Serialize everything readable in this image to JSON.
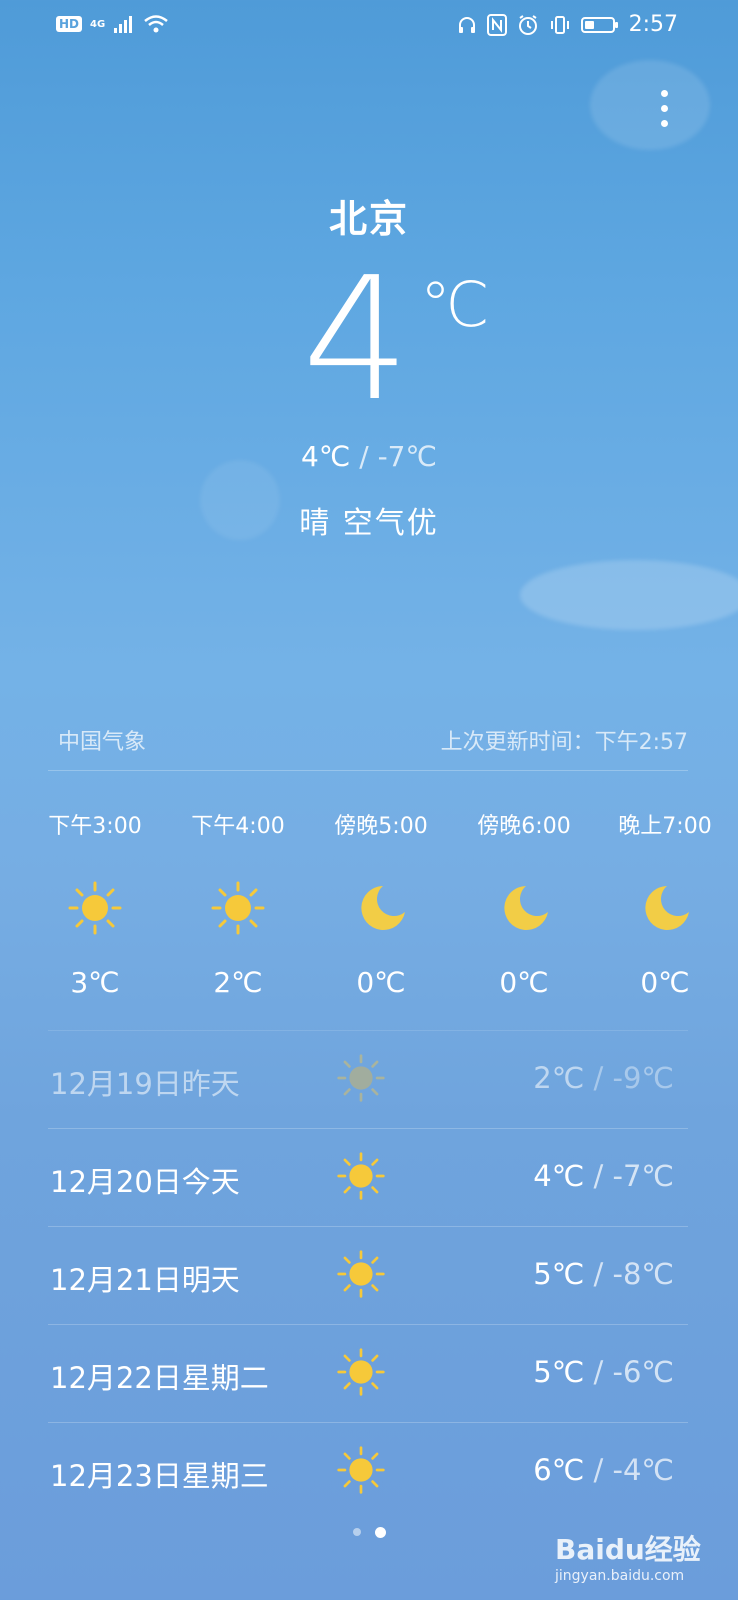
{
  "status_bar": {
    "hd": "HD",
    "network": "4G",
    "time": "2:57",
    "icons": [
      "signal-icon",
      "wifi-icon",
      "headset-icon",
      "nfc-icon",
      "alarm-icon",
      "vibrate-icon",
      "battery-icon"
    ]
  },
  "current": {
    "city": "北京",
    "temp": "4",
    "unit": "℃",
    "high": "4℃",
    "low": "-7℃",
    "condition": "晴",
    "air": "空气优"
  },
  "source": {
    "provider": "中国气象",
    "updated": "上次更新时间：下午2:57"
  },
  "hourly": [
    {
      "time": "下午3:00",
      "icon": "sun-icon",
      "temp": "3℃"
    },
    {
      "time": "下午4:00",
      "icon": "sun-icon",
      "temp": "2℃"
    },
    {
      "time": "傍晚5:00",
      "icon": "moon-icon",
      "temp": "0℃"
    },
    {
      "time": "傍晚6:00",
      "icon": "moon-icon",
      "temp": "0℃"
    },
    {
      "time": "晚上7:00",
      "icon": "moon-icon",
      "temp": "0℃"
    }
  ],
  "daily": [
    {
      "date": "12月19日昨天",
      "icon": "sun-icon",
      "high": "2℃",
      "low": "-9℃"
    },
    {
      "date": "12月20日今天",
      "icon": "sun-icon",
      "high": "4℃",
      "low": "-7℃"
    },
    {
      "date": "12月21日明天",
      "icon": "sun-icon",
      "high": "5℃",
      "low": "-8℃"
    },
    {
      "date": "12月22日星期二",
      "icon": "sun-icon",
      "high": "5℃",
      "low": "-6℃"
    },
    {
      "date": "12月23日星期三",
      "icon": "sun-icon",
      "high": "6℃",
      "low": "-4℃"
    }
  ],
  "separator": "/",
  "pages": {
    "count": 2,
    "active": 2
  },
  "watermark": {
    "brand": "Baidu经验",
    "url": "jingyan.baidu.com"
  },
  "colors": {
    "sun": "#f6c93a",
    "moon": "#f2cd46",
    "sky_top": "#4f9bd8",
    "sky_bottom": "#6b9ddb"
  }
}
